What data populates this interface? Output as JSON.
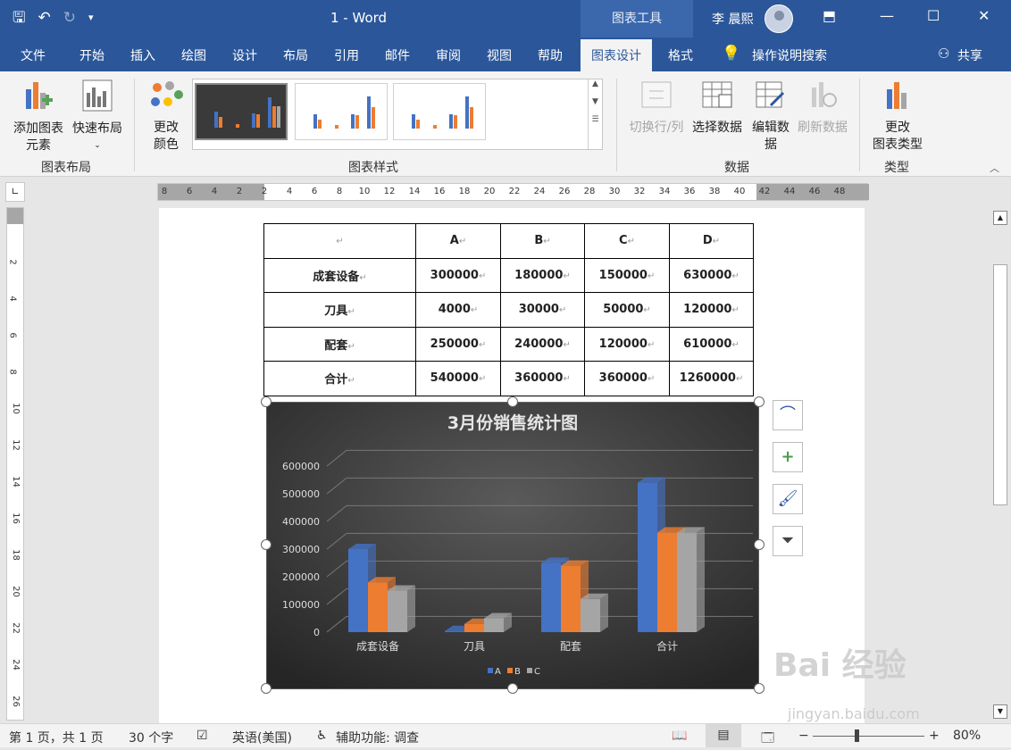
{
  "titlebar": {
    "doc_title": "1  -  Word",
    "tools_label": "图表工具",
    "user_name": "李 晨熙"
  },
  "tabs": [
    {
      "label": "文件"
    },
    {
      "label": "开始"
    },
    {
      "label": "插入"
    },
    {
      "label": "绘图"
    },
    {
      "label": "设计"
    },
    {
      "label": "布局"
    },
    {
      "label": "引用"
    },
    {
      "label": "邮件"
    },
    {
      "label": "审阅"
    },
    {
      "label": "视图"
    },
    {
      "label": "帮助"
    },
    {
      "label": "图表设计"
    },
    {
      "label": "格式"
    }
  ],
  "search_hint": "操作说明搜索",
  "share_label": "共享",
  "ribbon": {
    "add_element": "添加图表\n元素",
    "quick_layout": "快速布局",
    "group_layout": "图表布局",
    "change_colors": "更改\n颜色",
    "group_styles": "图表样式",
    "switch_rowcol": "切换行/列",
    "select_data": "选择数据",
    "edit_data": "编辑数\n据",
    "refresh_data": "刷新数据",
    "group_data": "数据",
    "change_type": "更改\n图表类型",
    "group_type": "类型"
  },
  "ruler_numbers": [
    "8",
    "6",
    "4",
    "2",
    "2",
    "4",
    "6",
    "8",
    "10",
    "12",
    "14",
    "16",
    "18",
    "20",
    "22",
    "24",
    "26",
    "28",
    "30",
    "32",
    "34",
    "36",
    "38",
    "40",
    "42",
    "44",
    "46",
    "48"
  ],
  "vruler_numbers": [
    "2",
    "4",
    "6",
    "8",
    "10",
    "12",
    "14",
    "16",
    "18",
    "20",
    "22",
    "24",
    "26"
  ],
  "table": {
    "headers": [
      "",
      "A",
      "B",
      "C",
      "D"
    ],
    "rows": [
      [
        "成套设备",
        "300000",
        "180000",
        "150000",
        "630000"
      ],
      [
        "刀具",
        "4000",
        "30000",
        "50000",
        "120000"
      ],
      [
        "配套",
        "250000",
        "240000",
        "120000",
        "610000"
      ],
      [
        "合计",
        "540000",
        "360000",
        "360000",
        "1260000"
      ]
    ]
  },
  "chart_data": {
    "type": "bar",
    "title": "3月份销售统计图",
    "categories": [
      "成套设备",
      "刀具",
      "配套",
      "合计"
    ],
    "series": [
      {
        "name": "A",
        "values": [
          300000,
          4000,
          250000,
          540000
        ],
        "color": "#4472c4"
      },
      {
        "name": "B",
        "values": [
          180000,
          30000,
          240000,
          360000
        ],
        "color": "#ed7d31"
      },
      {
        "name": "C",
        "values": [
          150000,
          50000,
          120000,
          360000
        ],
        "color": "#a5a5a5"
      }
    ],
    "ylim": [
      0,
      600000
    ],
    "yticks": [
      "0",
      "100000",
      "200000",
      "300000",
      "400000",
      "500000",
      "600000"
    ],
    "legend": "bottom",
    "grid": true,
    "background": "#3a3a3a"
  },
  "statusbar": {
    "page": "第 1 页，共 1 页",
    "words": "30 个字",
    "language": "英语(美国)",
    "accessibility": "辅助功能: 调查",
    "zoom": "80%"
  },
  "watermark": {
    "main": "Bai 经验",
    "sub": "jingyan.baidu.com"
  }
}
